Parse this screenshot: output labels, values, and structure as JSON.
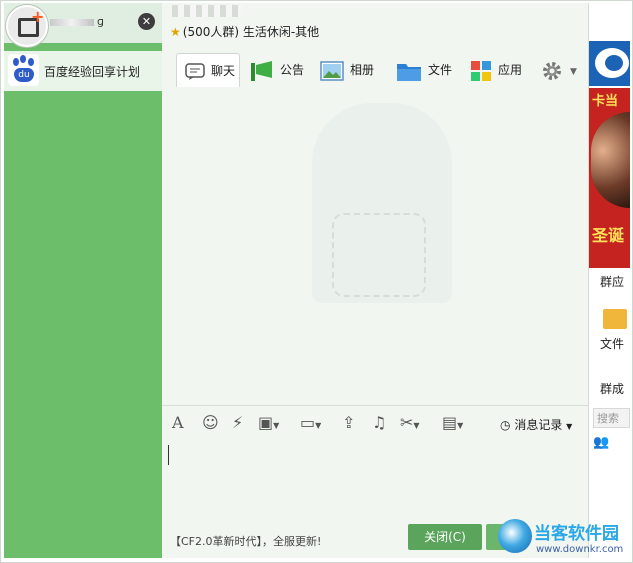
{
  "sidebar": {
    "user_name_suffix": "ɡ",
    "items": [
      {
        "label": "百度经验回享计划"
      }
    ]
  },
  "chat": {
    "group_info": "(500人群) 生活休闲-其他",
    "tabs": [
      {
        "label": "聊天",
        "icon": "chat-bubble-icon"
      },
      {
        "label": "公告",
        "icon": "megaphone-icon"
      },
      {
        "label": "相册",
        "icon": "photo-icon"
      },
      {
        "label": "文件",
        "icon": "folder-icon"
      },
      {
        "label": "应用",
        "icon": "apps-grid-icon"
      }
    ],
    "history_label": "消息记录",
    "promo_text": "【CF2.0革新时代】，全服更新!",
    "close_button": "关闭(C)"
  },
  "right_panel": {
    "ad_top_text": "卡当",
    "ad_mid_text": "圣诞",
    "group_apps_label": "群应",
    "file_label": "文件",
    "group_members_label": "群成",
    "search_placeholder": "搜索"
  },
  "watermark": {
    "title": "当客软件园",
    "url": "www.downkr.com"
  },
  "colors": {
    "sidebar_green": "#6cbe6b",
    "chat_bg": "#f1f6f1",
    "button_green": "#5aa45c",
    "ad_red": "#c5231f"
  }
}
